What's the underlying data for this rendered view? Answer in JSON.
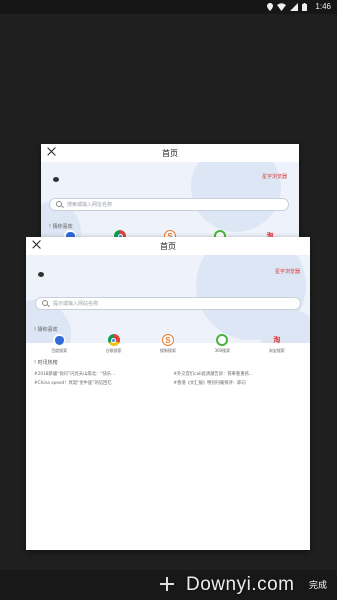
{
  "status_bar": {
    "time": "1:46",
    "icons": [
      "location-icon",
      "wifi-icon",
      "signal-icon",
      "battery-icon"
    ]
  },
  "tabs": [
    {
      "title": "首页",
      "brand": "星宇浏览器",
      "search_placeholder": "搜索或输入网址名称",
      "recommend_label": "! 猜你喜欢"
    },
    {
      "title": "首页",
      "brand": "星宇浏览器",
      "search_placeholder": "提示或输入网站名称",
      "recommend_label": "! 猜你喜欢",
      "apps": [
        {
          "label": "百度搜索",
          "icon": "baidu-icon"
        },
        {
          "label": "谷歌搜索",
          "icon": "chrome-icon"
        },
        {
          "label": "搜狗搜索",
          "icon": "sogou-icon",
          "glyph": "S"
        },
        {
          "label": "360搜索",
          "icon": "360-icon"
        },
        {
          "label": "淘宝搜索",
          "icon": "taobao-icon",
          "glyph": "淘"
        }
      ],
      "news_label": "! 时讯热榜",
      "news": [
        [
          "#2018新疆“快闪”闪亮天山南北：“快乐...",
          "#外交官们call此清澈告诉：铁拳重重抓..."
        ],
        [
          "#China speed！冥诞“金牛座”的信回忆",
          "#香港《文汇报》特别刊载快评：即向"
        ]
      ]
    }
  ],
  "bottom_bar": {
    "add_label": "+",
    "done_label": "完成"
  },
  "watermark": "Downyi.com",
  "colors": {
    "background": "#1f1f1f",
    "brand_red": "#d8393c",
    "hero_bg": "#eef3fb"
  }
}
